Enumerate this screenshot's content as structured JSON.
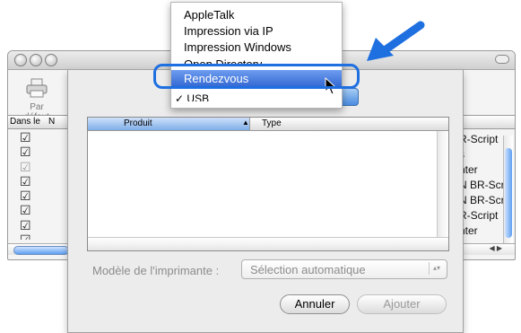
{
  "background_window": {
    "toolbar": {
      "default_label": "Par défaut"
    },
    "columns": {
      "in_menu": "Dans le",
      "name_col_initial": "N"
    },
    "checkboxes": [
      true,
      true,
      false,
      true,
      true,
      true,
      true,
      true
    ],
    "right_snippets": [
      "R-Script",
      "",
      "s",
      "nter",
      "N BR-Scri",
      "N BR-Scri",
      "R-Script",
      "nter"
    ]
  },
  "menu": {
    "items": [
      "AppleTalk",
      "Impression via IP",
      "Impression Windows",
      "Open Directory",
      "Rendezvous",
      "USB"
    ],
    "selected": "Rendezvous",
    "usb_prefix": "✓"
  },
  "sheet": {
    "table": {
      "col_product": "Produit",
      "col_type": "Type",
      "sort_indicator": "▲"
    },
    "model_label": "Modèle de l'imprimante :",
    "model_value": "Sélection automatique",
    "stepper": "▴▾",
    "cancel_label": "Annuler",
    "add_label": "Ajouter"
  },
  "colors": {
    "highlight": "#2d62cf",
    "annotation_blue": "#1e6fe0"
  },
  "icons": [
    "printer-icon",
    "arrow-icon",
    "cursor-icon",
    "sort-ascending-icon",
    "stepper-icon"
  ]
}
